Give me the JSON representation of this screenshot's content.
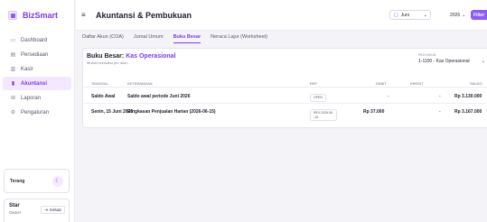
{
  "app": {
    "brand_name": "BizSmart",
    "logo_icon": "app-logo-icon"
  },
  "sidebar": {
    "items": [
      {
        "label": "Dashboard",
        "icon": "dashboard-icon",
        "glyph": "▭",
        "active": false
      },
      {
        "label": "Persediaan",
        "icon": "boxes-icon",
        "glyph": "▤",
        "active": false
      },
      {
        "label": "Kasir",
        "icon": "cashier-icon",
        "glyph": "▥",
        "active": false
      },
      {
        "label": "Akuntansi",
        "icon": "book-icon",
        "glyph": "▮",
        "active": true
      },
      {
        "label": "Laporan",
        "icon": "chart-icon",
        "glyph": "⊞",
        "active": false
      },
      {
        "label": "Pengaturan",
        "icon": "gear-icon",
        "glyph": "⚙",
        "active": false
      }
    ],
    "theme": {
      "label": "Terang",
      "toggle_glyph": "☾"
    },
    "user": {
      "name": "Star",
      "role": "Owner",
      "logout_label": "Keluar",
      "logout_glyph": "⇥"
    }
  },
  "header": {
    "title": "Akuntansi & Pembukuan",
    "menu_glyph": "≡",
    "month": "Juni",
    "year": "2026",
    "filter_label": "Filter"
  },
  "tabs": [
    {
      "label": "Daftar Akun (COA)",
      "active": false
    },
    {
      "label": "Jurnal Umum",
      "active": false
    },
    {
      "label": "Buku Besar",
      "active": true
    },
    {
      "label": "Neraca Lajur (Worksheet)",
      "active": false
    }
  ],
  "ledger": {
    "title_prefix": "Buku Besar:",
    "account_name": "Kas Operasional",
    "subtitle": "Mutasi transaksi per akun",
    "picker_label": "PILIH AKUN",
    "picker_value": "1-1100 - Kas Operasional",
    "columns": [
      "TANGGAL",
      "KETERANGAN",
      "REF",
      "DEBIT",
      "KREDIT",
      "SALDO"
    ],
    "rows": [
      {
        "date": "Saldo Awal",
        "description": "Saldo awal periode Juni 2026",
        "ref": "OPEN",
        "debit": "-",
        "credit": "-",
        "balance": "Rp 3.130.000"
      },
      {
        "date": "Senin, 15 Juni 2026",
        "description": "Ringkasan Penjualan Harian (2026-06-15)",
        "ref": "REV-2026-06-15",
        "debit": "Rp 37.000",
        "credit": "-",
        "balance": "Rp 3.167.000"
      }
    ]
  },
  "colors": {
    "accent": "#7c3aed",
    "accent_light": "#f3e8ff",
    "button": "#8b5cf6"
  }
}
